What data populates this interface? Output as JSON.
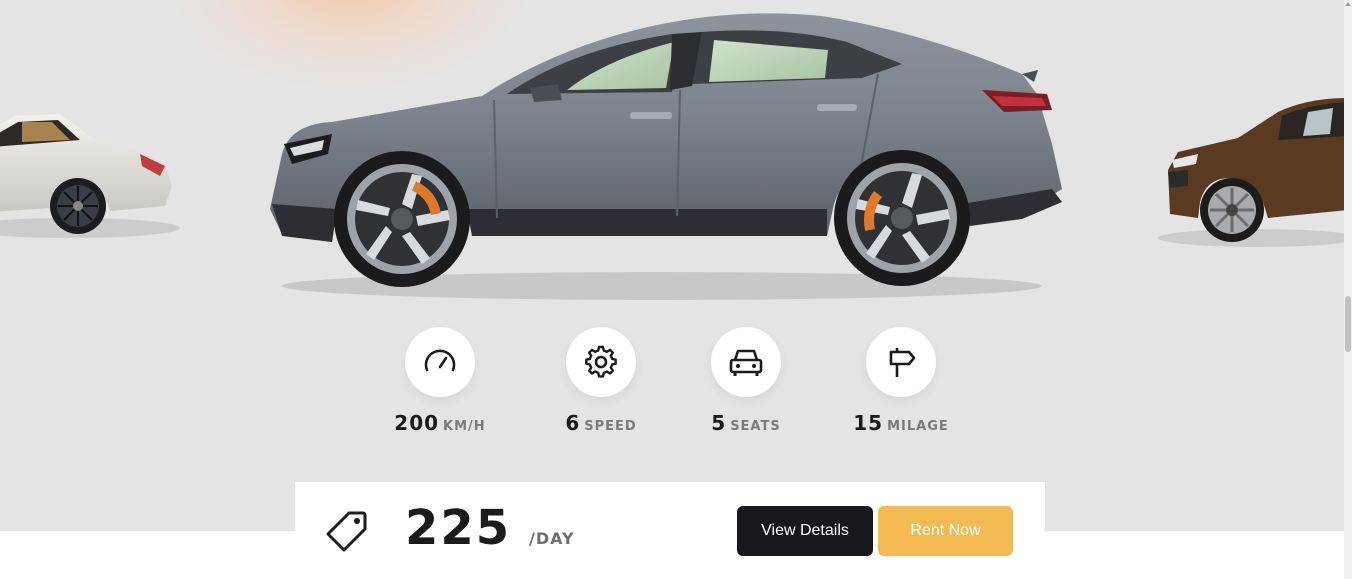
{
  "specs": [
    {
      "icon": "speedometer-icon",
      "value": "200",
      "unit": "km/h"
    },
    {
      "icon": "gear-icon",
      "value": "6",
      "unit": "speed"
    },
    {
      "icon": "car-front-icon",
      "value": "5",
      "unit": "seats"
    },
    {
      "icon": "signpost-icon",
      "value": "15",
      "unit": "milage"
    }
  ],
  "pricing": {
    "icon": "price-tag-icon",
    "amount": "225",
    "period": "/day"
  },
  "actions": {
    "view_details": "View Details",
    "rent_now": "Rent Now"
  },
  "colors": {
    "stage_background": "#e4e4e4",
    "primary_dark": "#17181c",
    "accent": "#f3ba53"
  }
}
